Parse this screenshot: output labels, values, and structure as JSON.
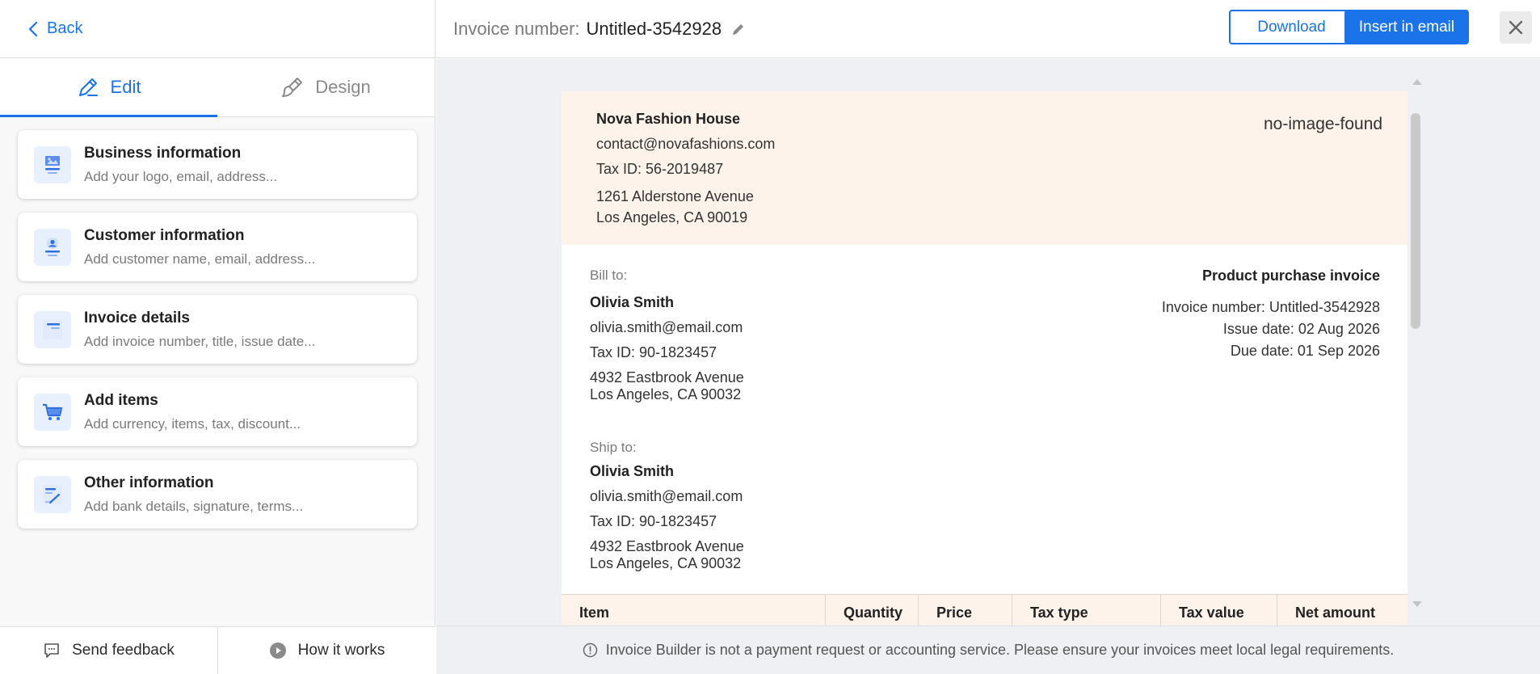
{
  "left_panel": {
    "back_label": "Back",
    "tabs": [
      {
        "label": "Edit",
        "icon": "pencil-icon",
        "active": true
      },
      {
        "label": "Design",
        "icon": "brush-icon",
        "active": false
      }
    ],
    "cards": [
      {
        "title": "Business information",
        "subtitle": "Add your logo, email, address...",
        "icon": "business-image-icon"
      },
      {
        "title": "Customer information",
        "subtitle": "Add customer name, email, address...",
        "icon": "customer-icon"
      },
      {
        "title": "Invoice details",
        "subtitle": "Add invoice number, title, issue date...",
        "icon": "document-icon"
      },
      {
        "title": "Add items",
        "subtitle": "Add currency, items, tax, discount...",
        "icon": "cart-icon"
      },
      {
        "title": "Other information",
        "subtitle": "Add bank details, signature, terms...",
        "icon": "signature-icon"
      }
    ],
    "footer": {
      "feedback_label": "Send feedback",
      "how_label": "How it works"
    }
  },
  "topbar": {
    "invoice_label": "Invoice number:",
    "invoice_value": "Untitled-3542928",
    "download_label": "Download",
    "insert_label": "Insert in email"
  },
  "invoice": {
    "business": {
      "name": "Nova Fashion House",
      "email": "contact@novafashions.com",
      "tax_id": "Tax ID: 56-2019487",
      "address_line1": "1261 Alderstone Avenue",
      "address_line2": "Los Angeles, CA 90019",
      "logo_alt": "no-image-found"
    },
    "bill_to": {
      "label": "Bill to:",
      "name": "Olivia Smith",
      "email": "olivia.smith@email.com",
      "tax_id": "Tax ID: 90-1823457",
      "address_line1": "4932 Eastbrook Avenue",
      "address_line2": "Los Angeles, CA 90032"
    },
    "ship_to": {
      "label": "Ship to:",
      "name": "Olivia Smith",
      "email": "olivia.smith@email.com",
      "tax_id": "Tax ID: 90-1823457",
      "address_line1": "4932 Eastbrook Avenue",
      "address_line2": "Los Angeles, CA 90032"
    },
    "meta": {
      "title": "Product purchase invoice",
      "invoice_number": "Invoice number: Untitled-3542928",
      "issue_date": "Issue date: 02 Aug 2026",
      "due_date": "Due date: 01 Sep 2026"
    },
    "item_columns": [
      "Item",
      "Quantity",
      "Price",
      "Tax type",
      "Tax value",
      "Net amount"
    ]
  },
  "disclaimer": "Invoice Builder is not a payment request or accounting service. Please ensure your invoices meet local legal requirements.",
  "colors": {
    "accent": "#1a73e8",
    "header_tint": "#fdf3ea",
    "preview_bg": "#eef0f3"
  }
}
